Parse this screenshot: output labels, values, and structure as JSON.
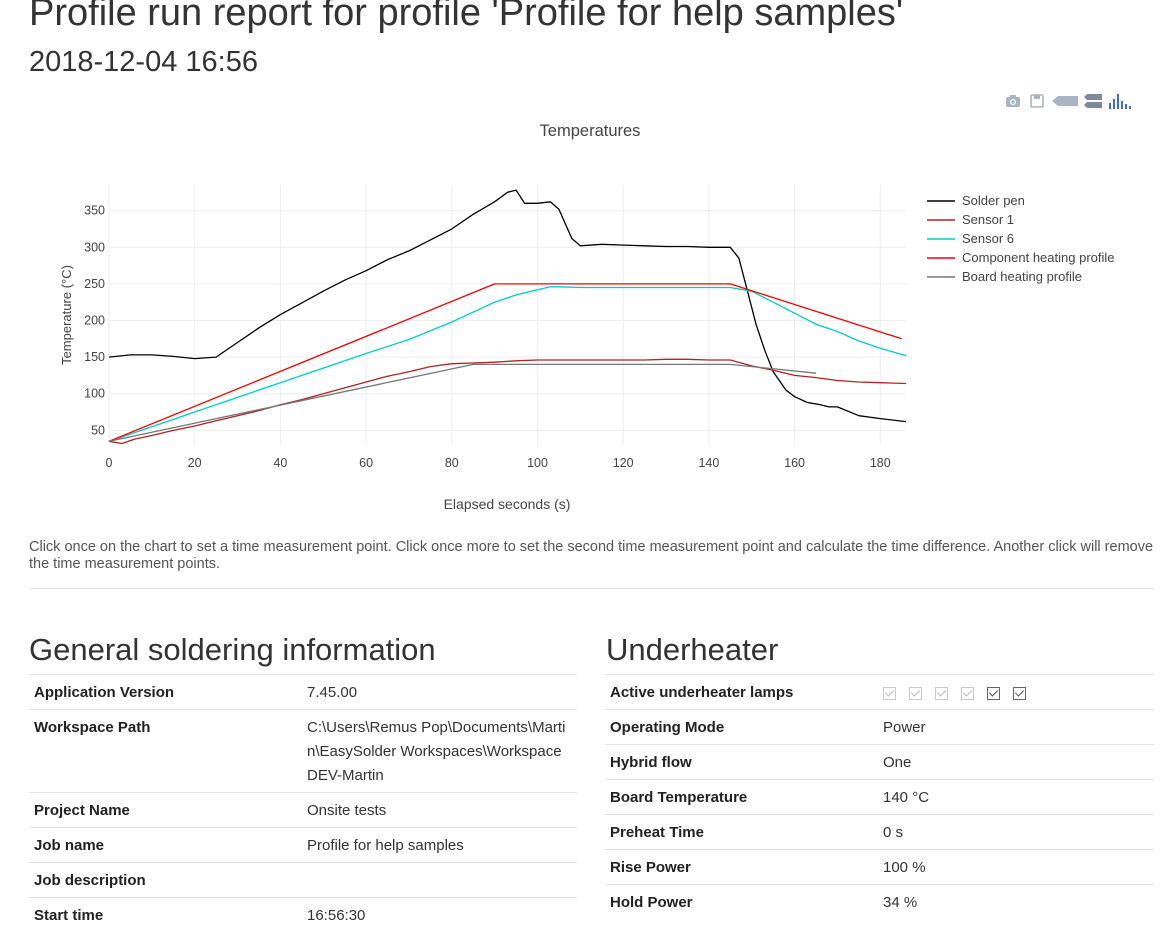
{
  "page": {
    "title": "Profile run report for profile 'Profile for help samples'",
    "date": "2018-12-04 16:56",
    "hint": "Click once on the chart to set a time measurement point. Click once more to set the second time measurement point and calculate the time difference. Another click will remove the time measurement points."
  },
  "modebar": [
    "camera-icon",
    "save-icon",
    "hover-closest-icon",
    "hover-compare-icon",
    "plotly-logo-icon"
  ],
  "chart_data": {
    "type": "line",
    "title": "Temperatures",
    "xlabel": "Elapsed seconds (s)",
    "ylabel": "Temperature (°C)",
    "xlim": [
      0,
      186
    ],
    "ylim": [
      30,
      385
    ],
    "xticks": [
      0,
      20,
      40,
      60,
      80,
      100,
      120,
      140,
      160,
      180
    ],
    "yticks": [
      50,
      100,
      150,
      200,
      250,
      300,
      350
    ],
    "grid": true,
    "legend_position": "right",
    "series": [
      {
        "name": "Solder pen",
        "color": "#000000",
        "x": [
          0,
          5,
          10,
          15,
          20,
          25,
          30,
          35,
          40,
          45,
          50,
          55,
          60,
          65,
          70,
          75,
          80,
          85,
          90,
          93,
          95,
          97,
          100,
          103,
          105,
          108,
          110,
          115,
          120,
          125,
          130,
          135,
          140,
          145,
          147,
          149,
          151,
          153,
          155,
          158,
          160,
          163,
          166,
          168,
          170,
          175,
          180,
          186
        ],
        "y": [
          150,
          153,
          153,
          151,
          148,
          150,
          170,
          190,
          208,
          224,
          240,
          255,
          268,
          283,
          295,
          310,
          325,
          345,
          362,
          375,
          378,
          360,
          360,
          362,
          352,
          312,
          302,
          304,
          303,
          302,
          301,
          301,
          300,
          300,
          285,
          240,
          195,
          160,
          130,
          105,
          96,
          88,
          85,
          82,
          82,
          70,
          66,
          62
        ]
      },
      {
        "name": "Sensor 1",
        "color": "#b22222",
        "x": [
          0,
          3,
          6,
          10,
          15,
          20,
          25,
          30,
          35,
          40,
          45,
          50,
          55,
          60,
          65,
          70,
          75,
          80,
          85,
          90,
          95,
          100,
          105,
          110,
          115,
          120,
          125,
          130,
          135,
          140,
          145,
          150,
          155,
          160,
          165,
          170,
          175,
          180,
          186
        ],
        "y": [
          35,
          32,
          38,
          43,
          50,
          56,
          63,
          70,
          77,
          85,
          92,
          100,
          108,
          116,
          124,
          130,
          137,
          141,
          142,
          143,
          145,
          146,
          146,
          146,
          146,
          146,
          146,
          147,
          147,
          146,
          146,
          138,
          132,
          125,
          122,
          118,
          116,
          115,
          114
        ]
      },
      {
        "name": "Sensor 6",
        "color": "#00cccc",
        "x": [
          0,
          10,
          20,
          30,
          40,
          50,
          60,
          70,
          80,
          90,
          95,
          100,
          103,
          105,
          110,
          120,
          130,
          140,
          145,
          150,
          155,
          160,
          165,
          170,
          175,
          180,
          186
        ],
        "y": [
          35,
          55,
          75,
          95,
          115,
          135,
          155,
          174,
          198,
          225,
          235,
          242,
          246,
          246,
          245,
          245,
          245,
          245,
          245,
          240,
          225,
          210,
          195,
          185,
          172,
          162,
          152
        ]
      },
      {
        "name": "Component heating profile",
        "color": "#ff0000",
        "x": [
          0,
          90,
          145,
          185
        ],
        "y": [
          35,
          250,
          250,
          175
        ]
      },
      {
        "name": "Board heating profile",
        "color": "#777777",
        "x": [
          0,
          85,
          145,
          165
        ],
        "y": [
          35,
          140,
          140,
          128
        ]
      }
    ]
  },
  "general": {
    "title": "General soldering information",
    "rows": [
      {
        "key": "Application Version",
        "value": "7.45.00"
      },
      {
        "key": "Workspace Path",
        "value": "C:\\Users\\Remus Pop\\Documents\\Martin\\EasySolder Workspaces\\Workspace DEV-Martin"
      },
      {
        "key": "Project Name",
        "value": "Onsite tests"
      },
      {
        "key": "Job name",
        "value": "Profile for help samples"
      },
      {
        "key": "Job description",
        "value": ""
      },
      {
        "key": "Start time",
        "value": "16:56:30"
      }
    ]
  },
  "underheater": {
    "title": "Underheater",
    "lamps_label": "Active underheater lamps",
    "lamps": [
      true,
      true,
      true,
      true,
      true,
      true
    ],
    "lamps_dark": [
      false,
      false,
      false,
      false,
      true,
      true
    ],
    "rows": [
      {
        "key": "Operating Mode",
        "value": "Power"
      },
      {
        "key": "Hybrid flow",
        "value": "One"
      },
      {
        "key": "Board Temperature",
        "value": "140 °C"
      },
      {
        "key": "Preheat Time",
        "value": "0 s"
      },
      {
        "key": "Rise Power",
        "value": "100 %"
      },
      {
        "key": "Hold Power",
        "value": "34 %"
      }
    ]
  }
}
